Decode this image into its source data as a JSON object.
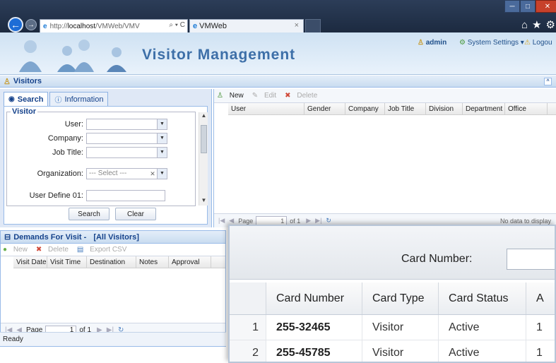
{
  "browser": {
    "address_prefix": "http://",
    "address_host": "localhost",
    "address_path": "/VMWeb/VMV",
    "address_tools": "⌕ ▾ C",
    "tab_title": "VMWeb",
    "tab_close": "×"
  },
  "app": {
    "title": "Visitor Management",
    "user": "admin",
    "settings_label": "System Settings ▾",
    "logout_label": "Logou"
  },
  "visitors_bar": {
    "title": "Visitors"
  },
  "search_tabs": [
    {
      "label": "Search"
    },
    {
      "label": "Information"
    }
  ],
  "visitor_form": {
    "legend": "Visitor",
    "user_label": "User:",
    "company_label": "Company:",
    "job_title_label": "Job Title:",
    "organization_label": "Organization:",
    "organization_value": "--- Select ---",
    "user_define_label": "User Define 01:",
    "search_button": "Search",
    "clear_button": "Clear"
  },
  "visitors_grid": {
    "toolbar": {
      "new": "New",
      "edit": "Edit",
      "delete": "Delete"
    },
    "columns": [
      "User",
      "Gender",
      "Company",
      "Job Title",
      "Division",
      "Department",
      "Office"
    ],
    "pager": {
      "page_label": "Page",
      "page_value": "1",
      "of_label": "of 1",
      "no_data": "No data to display"
    }
  },
  "demands": {
    "title": "Demands For Visit -",
    "filter": "[All Visitors]",
    "toolbar": {
      "new": "New",
      "delete": "Delete",
      "export": "Export CSV"
    },
    "columns": [
      "Visit Date",
      "Visit Time",
      "Destination",
      "Notes",
      "Approval"
    ],
    "pager": {
      "page_label": "Page",
      "page_value": "1",
      "of_label": "of 1"
    }
  },
  "status": {
    "text": "Ready"
  },
  "card_popup": {
    "label": "Card Number:",
    "columns": [
      "Card Number",
      "Card Type",
      "Card Status",
      "A"
    ],
    "rows": [
      {
        "num": "1",
        "card_number": "255-32465",
        "card_type": "Visitor",
        "card_status": "Active",
        "extra": "1"
      },
      {
        "num": "2",
        "card_number": "255-45785",
        "card_type": "Visitor",
        "card_status": "Active",
        "extra": "1"
      }
    ]
  }
}
